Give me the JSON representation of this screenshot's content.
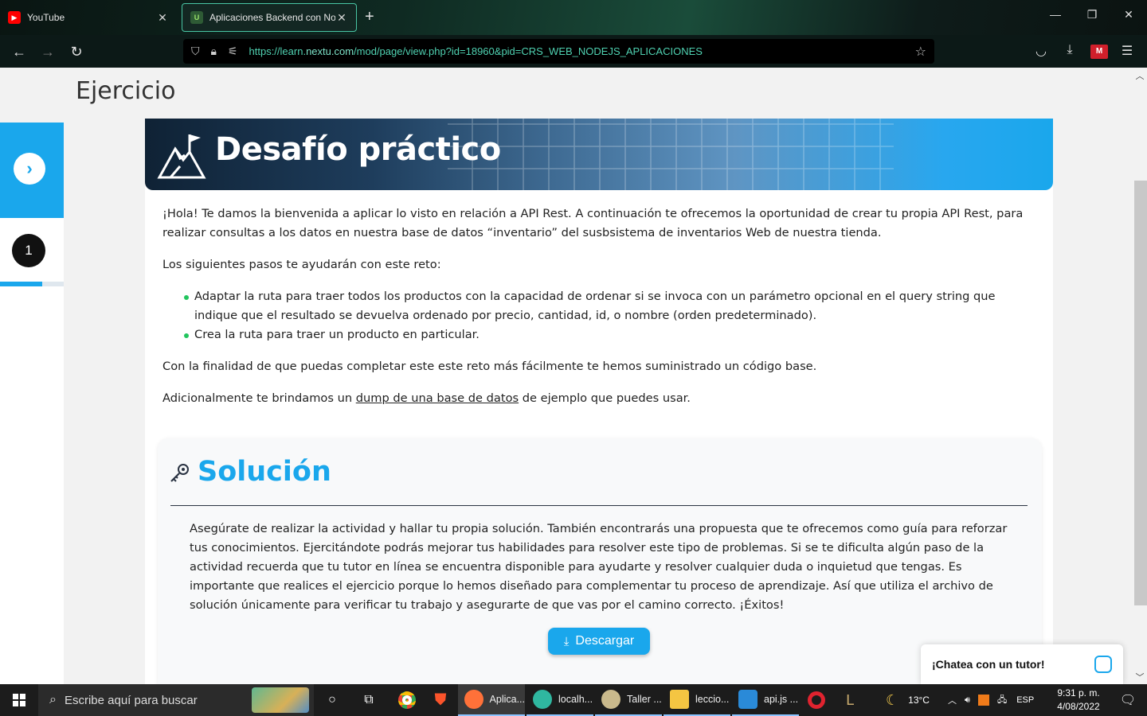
{
  "browser": {
    "tabs": [
      {
        "title": "YouTube",
        "favicon": "youtube-icon",
        "active": false
      },
      {
        "title": "Aplicaciones Backend con NodeJS",
        "favicon": "nextu-icon",
        "active": true
      }
    ],
    "url_prefix": "https://learn.",
    "url_domain": "nextu.com",
    "url_path": "/mod/page/view.php?id=18960&pid=CRS_WEB_NODEJS_APLICACIONES",
    "accent": "#49c6a5"
  },
  "page": {
    "title": "Ejercicio",
    "sidebar": {
      "step_number": "1",
      "progress": 0.66
    },
    "banner_title": "Desafío práctico",
    "intro_p1": "¡Hola! Te damos la bienvenida a aplicar lo visto en relación a API Rest. A continuación te ofrecemos la oportunidad de crear tu propia API Rest, para realizar consultas a los datos en nuestra base de datos “inventario” del susbsistema de inventarios Web de nuestra tienda.",
    "intro_p2": "Los siguientes pasos te ayudarán con este reto:",
    "steps": [
      "Adaptar la ruta para traer todos los productos con la capacidad de ordenar si se invoca con un parámetro opcional en el query string que indique que el resultado se devuelva ordenado por precio, cantidad, id, o nombre (orden predeterminado).",
      "Crea la ruta para traer un producto en particular."
    ],
    "p3": "Con la finalidad de que puedas completar este este reto más fácilmente te hemos suministrado un código base.",
    "p4_before": "Adicionalmente te brindamos un ",
    "p4_link": "dump de una base de datos",
    "p4_after": " de ejemplo que puedes usar.",
    "solution": {
      "title": "Solución",
      "text": "Asegúrate de realizar la actividad y hallar tu propia solución. También encontrarás una propuesta que te ofrecemos como guía para reforzar tus conocimientos. Ejercitándote podrás mejorar tus habilidades para resolver este tipo de problemas. Si se te dificulta algún paso de la actividad recuerda que tu tutor en línea se encuentra disponible para ayudarte y resolver cualquier duda o inquietud que tengas. Es importante que realices el ejercicio porque lo hemos diseñado para complementar tu proceso de aprendizaje. Así que utiliza el archivo de solución únicamente para verificar tu trabajo y asegurarte de que vas por el camino correcto. ¡Éxitos!",
      "button": "Descargar"
    },
    "chat_label": "¡Chatea con un tutor!",
    "accent": "#1aa7ec"
  },
  "taskbar": {
    "search_placeholder": "Escribe aquí para buscar",
    "apps": [
      {
        "label": "Aplica...",
        "icon": "firefox-icon",
        "color": "#ff7139"
      },
      {
        "label": "localh...",
        "icon": "edge-icon",
        "color": "#2fb7a0"
      },
      {
        "label": "Taller ...",
        "icon": "paint-icon",
        "color": "#c9b98c"
      },
      {
        "label": "leccio...",
        "icon": "folder-icon",
        "color": "#f4c542"
      },
      {
        "label": "api.js ...",
        "icon": "vscode-icon",
        "color": "#2a8ad8"
      }
    ],
    "weather": "13°C",
    "language": "ESP",
    "time": "9:31 p. m.",
    "date": "4/08/2022"
  }
}
